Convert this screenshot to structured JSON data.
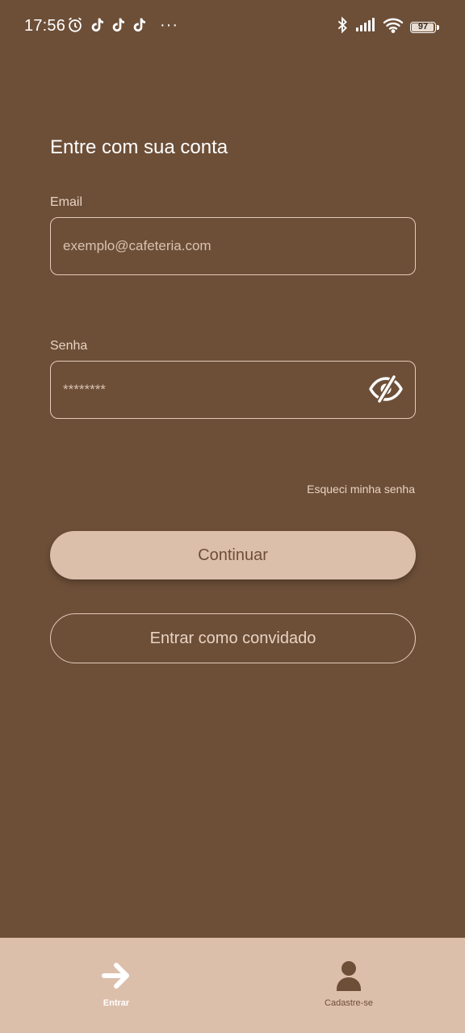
{
  "status_bar": {
    "time": "17:56",
    "battery": "97",
    "battery_level": 0.97,
    "more_indicator": "···",
    "icons_left": [
      "alarm-icon",
      "tiktok-icon",
      "tiktok-icon",
      "tiktok-icon"
    ],
    "icons_right": [
      "bluetooth-icon",
      "signal-icon",
      "wifi-icon",
      "battery-icon"
    ]
  },
  "login": {
    "heading": "Entre com sua conta",
    "email_label": "Email",
    "email_placeholder": "exemplo@cafeteria.com",
    "email_value": "",
    "password_label": "Senha",
    "password_placeholder": "********",
    "password_value": "",
    "password_toggle_icon": "eye-off-icon",
    "forgot_password": "Esqueci minha senha",
    "continue_button": "Continuar",
    "guest_button": "Entrar como convidado"
  },
  "bottom_nav": {
    "items": [
      {
        "label": "Entrar",
        "icon": "arrow-right-icon",
        "active": true
      },
      {
        "label": "Cadastre-se",
        "icon": "person-icon",
        "active": false
      }
    ]
  },
  "colors": {
    "background": "#6d4f38",
    "accent": "#dcbfab",
    "text_light": "#e8d3c3",
    "white": "#ffffff"
  }
}
